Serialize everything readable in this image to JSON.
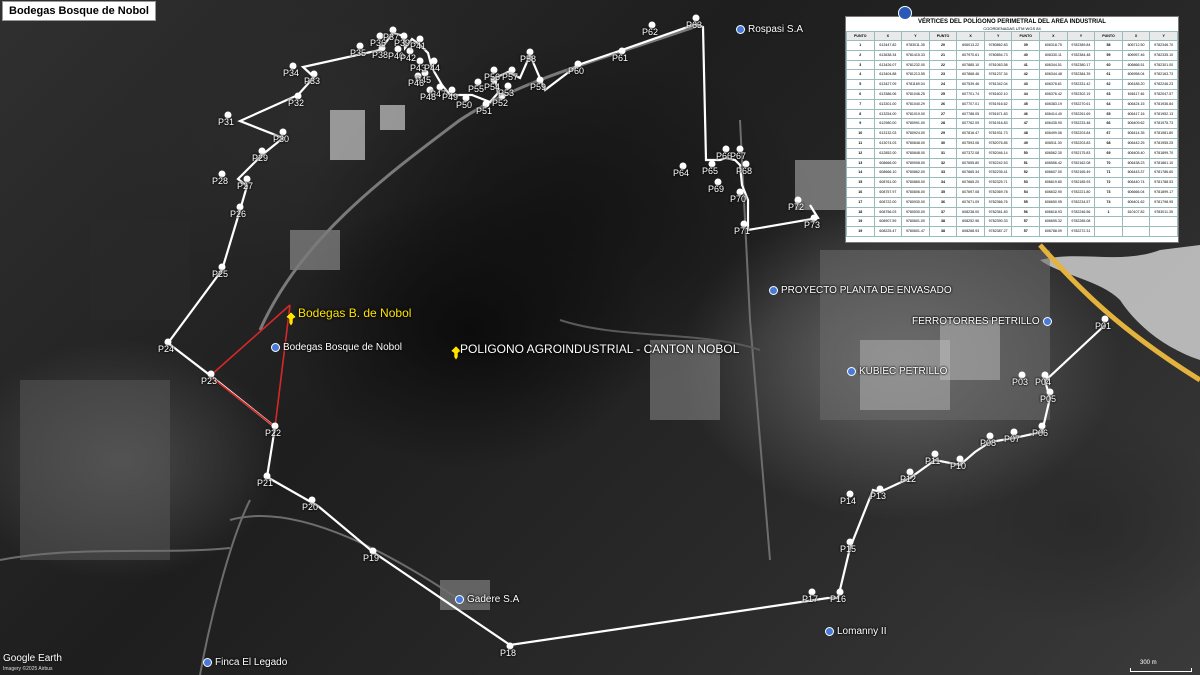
{
  "map": {
    "title": "Bodegas Bosque de Nobol",
    "brand": "Google Earth",
    "brand_sub": "Imagery ©2025 Airbus",
    "scale_label": "300 m",
    "main_pins": [
      {
        "id": "bodegas",
        "label": "Bodegas B. de Nobol"
      },
      {
        "id": "poligono",
        "label": "POLIGONO AGROINDUSTRIAL - CANTON NOBOL"
      }
    ],
    "pois": [
      {
        "name": "Bodegas Bosque de Nobol"
      },
      {
        "name": "Rospasi S.A"
      },
      {
        "name": "PROYECTO PLANTA DE ENVASADO"
      },
      {
        "name": "FERROTORRES PETRILLO"
      },
      {
        "name": "KUBIEC PETRILLO"
      },
      {
        "name": "Gadere S.A"
      },
      {
        "name": "Lomanny II"
      },
      {
        "name": "Finca El Legado"
      }
    ],
    "polygon_points": [
      "P01",
      "P03",
      "P04",
      "P05",
      "P06",
      "P07",
      "P08",
      "P11",
      "P10",
      "P12",
      "P13",
      "P14",
      "P15",
      "P16",
      "P17",
      "P18",
      "P19",
      "P20",
      "P21",
      "P22",
      "P23",
      "P24",
      "P25",
      "P26",
      "P27",
      "P28",
      "P29",
      "P30",
      "P31",
      "P32",
      "P33",
      "P34",
      "P35",
      "P36",
      "P37",
      "P38",
      "P39",
      "P40",
      "P41",
      "P42",
      "P43",
      "P44",
      "P45",
      "P46",
      "P47",
      "P48",
      "P49",
      "P50",
      "P51",
      "P52",
      "P53",
      "P54",
      "P55",
      "P56",
      "P57",
      "P58",
      "P59",
      "P60",
      "P61",
      "P62",
      "P63",
      "P64",
      "P65",
      "P66",
      "P67",
      "P68",
      "P69",
      "P70",
      "P71",
      "P72",
      "P73"
    ],
    "highlight_color": "#d62828",
    "route_color": "#ffffff",
    "road_color": "#e3b33d"
  },
  "vertices_table": {
    "title": "VÉRTICES DEL POLÍGONO PERIMETRAL DEL AREA INDUSTRIAL",
    "subtitle": "COORDENADAS UTM WGS 84",
    "headers": [
      "PUNTO",
      "X",
      "Y",
      "PUNTO",
      "X",
      "Y",
      "PUNTO",
      "X",
      "Y",
      "PUNTO",
      "X",
      "Y"
    ],
    "rows": [
      [
        "1",
        "613447.82",
        "9783011.35",
        "20",
        "606013.22",
        "9780862.83",
        "39",
        "606318.75",
        "9782389.84",
        "58",
        "606712.50",
        "9782346.70"
      ],
      [
        "2",
        "613638.34",
        "9781415.33",
        "21",
        "607970.61",
        "9780854.73",
        "40",
        "606330.11",
        "9782384.48",
        "59",
        "606957.46",
        "9782335.10"
      ],
      [
        "3",
        "613426.07",
        "9781232.00",
        "22",
        "607885.10",
        "9781063.58",
        "41",
        "606344.51",
        "9782380.17",
        "60",
        "606866.51",
        "9782301.00"
      ],
      [
        "4",
        "613404.88",
        "9781213.55",
        "23",
        "607868.46",
        "9781237.34",
        "42",
        "606344.48",
        "9782384.39",
        "61",
        "606958.04",
        "9782163.73"
      ],
      [
        "5",
        "613427.09",
        "9781169.04",
        "24",
        "607539.46",
        "9781342.04",
        "43",
        "606378.61",
        "9782331.42",
        "62",
        "606185.20",
        "9782246.23"
      ],
      [
        "6",
        "613386.06",
        "9781046.25",
        "25",
        "607701.74",
        "9781602.10",
        "44",
        "606376.42",
        "9782302.19",
        "63",
        "606117.46",
        "9782047.57"
      ],
      [
        "7",
        "613301.00",
        "9781040.29",
        "26",
        "607707.01",
        "9781916.62",
        "45",
        "606383.19",
        "9782270.61",
        "64",
        "606424.15",
        "9781936.84"
      ],
      [
        "8",
        "613254.00",
        "9781019.00",
        "27",
        "607788.05",
        "9781671.83",
        "46",
        "606414.40",
        "9782261.69",
        "65",
        "606417.16",
        "9781952.13"
      ],
      [
        "9",
        "612980.00",
        "9780991.00",
        "28",
        "607762.09",
        "9781916.83",
        "47",
        "606435.90",
        "9782233.48",
        "66",
        "606409.62",
        "9781975.73"
      ],
      [
        "10",
        "613132.03",
        "9780924.00",
        "29",
        "607816.47",
        "9781931.73",
        "48",
        "606499.06",
        "9782203.84",
        "67",
        "606414.35",
        "9781981.80"
      ],
      [
        "11",
        "613074.03",
        "9780848.00",
        "30",
        "607593.06",
        "9782076.85",
        "49",
        "606511.30",
        "9782203.83",
        "68",
        "606442.25",
        "9781955.25"
      ],
      [
        "12",
        "612852.00",
        "9780848.00",
        "31",
        "607372.08",
        "9782046.14",
        "50",
        "606562.30",
        "9782175.83",
        "69",
        "606405.40",
        "9781899.70"
      ],
      [
        "13",
        "608666.00",
        "9780908.00",
        "32",
        "607655.80",
        "9782242.53",
        "51",
        "606556.42",
        "9782162.08",
        "70",
        "606438.23",
        "9781861.10"
      ],
      [
        "14",
        "608666.10",
        "9780862.00",
        "33",
        "607665.34",
        "9782235.41",
        "52",
        "606607.00",
        "9782165.49",
        "71",
        "606443.37",
        "9781786.60"
      ],
      [
        "15",
        "608761.00",
        "9780865.00",
        "34",
        "607665.20",
        "9782325.71",
        "53",
        "606619.80",
        "9782185.93",
        "72",
        "606440.74",
        "9781788.53"
      ],
      [
        "16",
        "608757.97",
        "9780806.00",
        "35",
        "607697.08",
        "9782369.78",
        "54",
        "606632.90",
        "9782221.80",
        "73",
        "606666.04",
        "9781899.17"
      ],
      [
        "17",
        "608722.00",
        "9780930.00",
        "36",
        "607671.09",
        "9782366.76",
        "55",
        "606650.95",
        "9782234.57",
        "74",
        "606401.62",
        "9781798.95"
      ],
      [
        "18",
        "608756.03",
        "9780530.00",
        "37",
        "608238.00",
        "9782361.83",
        "56",
        "606618.93",
        "9782246.56",
        "1",
        "610107.82",
        "9783011.35"
      ],
      [
        "19",
        "608907.59",
        "9780601.00",
        "38",
        "608252.96",
        "9782390.33",
        "57",
        "606695.32",
        "9782285.08",
        "",
        "",
        ""
      ],
      [
        "19",
        "608225.47",
        "9780601.47",
        "38",
        "608268.93",
        "9782387.27",
        "57",
        "606788.09",
        "9782272.31",
        "",
        "",
        ""
      ]
    ]
  }
}
